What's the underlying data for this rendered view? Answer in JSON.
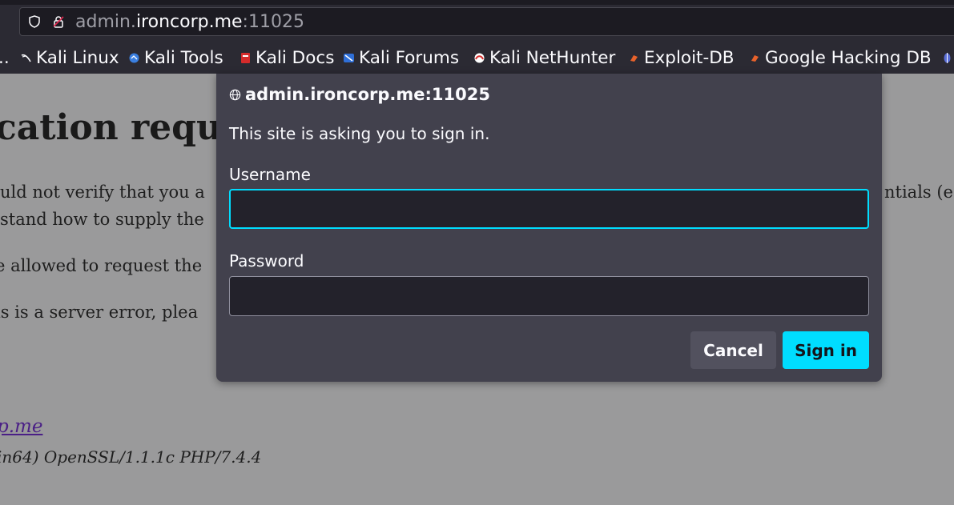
{
  "browser": {
    "url_dim_prefix": "admin.",
    "url_main": "ironcorp.me",
    "url_port": ":11025",
    "bookmarks_leading": "..",
    "bookmarks": [
      {
        "label": "Kali Linux",
        "icon": "kali-dragon-icon"
      },
      {
        "label": "Kali Tools",
        "icon": "kali-tools-icon"
      },
      {
        "label": "Kali Docs",
        "icon": "kali-docs-icon"
      },
      {
        "label": "Kali Forums",
        "icon": "kali-forums-icon"
      },
      {
        "label": "Kali NetHunter",
        "icon": "kali-nethunter-icon"
      },
      {
        "label": "Exploit-DB",
        "icon": "exploit-db-icon"
      },
      {
        "label": "Google Hacking DB",
        "icon": "ghdb-icon"
      }
    ]
  },
  "page": {
    "heading": "cation requi",
    "line1": "uld not verify that you a",
    "line1_right": "ntials (e.g.",
    "line2": "stand how to supply the",
    "line3": "e allowed to request the",
    "line4": "is is a server error, plea",
    "link": "p.me",
    "address": "in64) OpenSSL/1.1.1c PHP/7.4.4"
  },
  "dialog": {
    "host": "admin.ironcorp.me:11025",
    "message": "This site is asking you to sign in.",
    "username_label": "Username",
    "username_value": "",
    "password_label": "Password",
    "password_value": "",
    "cancel_label": "Cancel",
    "signin_label": "Sign in"
  },
  "colors": {
    "accent": "#00ddff",
    "dialog_bg": "#42414d",
    "chrome_bg": "#2b2a33"
  }
}
